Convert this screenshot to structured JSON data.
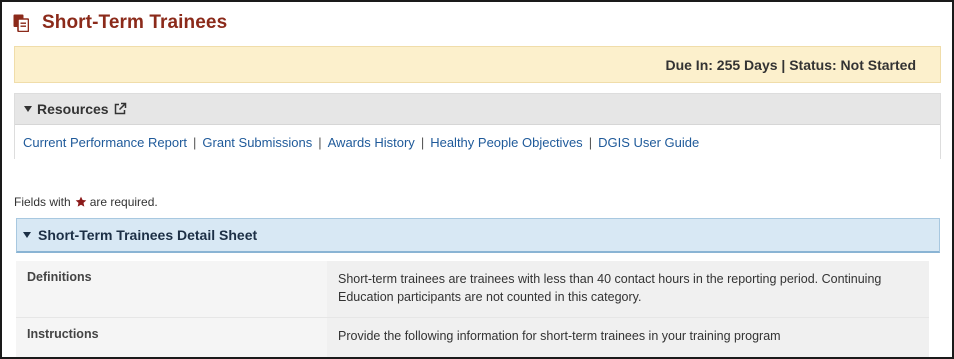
{
  "page": {
    "title": "Short-Term Trainees",
    "title_icon": "document-copy-icon"
  },
  "status": {
    "text": "Due In: 255 Days | Status: Not Started"
  },
  "resources": {
    "label": "Resources",
    "links": [
      "Current Performance Report",
      "Grant Submissions",
      "Awards History",
      "Healthy People Objectives",
      "DGIS User Guide"
    ],
    "separator": "|"
  },
  "required_note": {
    "before": "Fields with",
    "after": "are required."
  },
  "detail": {
    "title": "Short-Term Trainees Detail Sheet",
    "rows": [
      {
        "label": "Definitions",
        "value": "Short-term trainees are trainees with less than 40 contact hours in the reporting period. Continuing Education participants are not counted in this category."
      },
      {
        "label": "Instructions",
        "value": "Provide the following information for short-term trainees in your training program"
      }
    ]
  },
  "colors": {
    "title": "#8b2a1a",
    "status_bg": "#fcf0cc",
    "link": "#1f5a9a",
    "detail_header_bg": "#d8e8f4",
    "required_star": "#8b1a1a"
  }
}
